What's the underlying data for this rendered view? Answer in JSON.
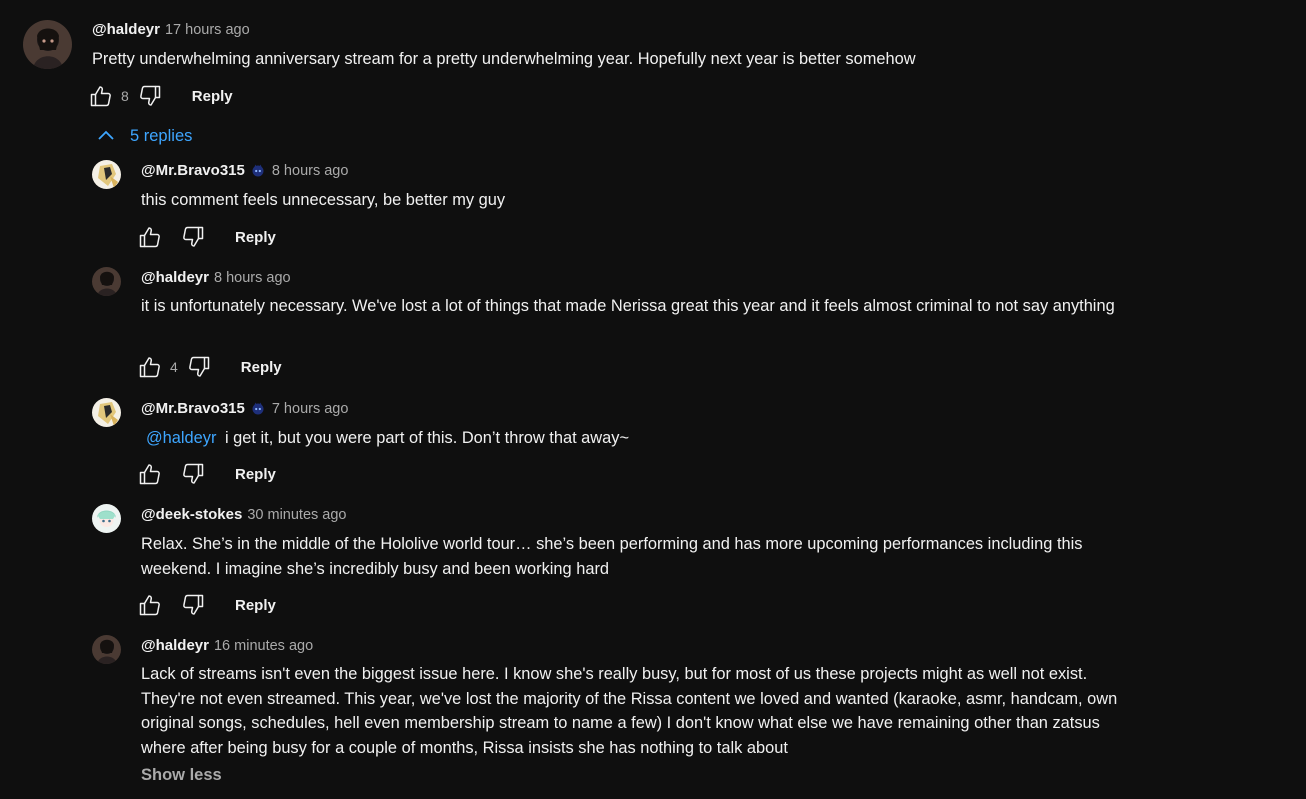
{
  "root_comment": {
    "author": "@haldeyr",
    "time": "17 hours ago",
    "text": "Pretty underwhelming anniversary stream for a pretty underwhelming year. Hopefully next year is better somehow",
    "likes": "8",
    "reply_label": "Reply",
    "avatar": "dark-haired-avatar"
  },
  "replies_toggle": {
    "label": "5 replies",
    "icon": "chevron-up-icon"
  },
  "replies": [
    {
      "author": "@Mr.Bravo315",
      "has_member_badge": true,
      "time": "8 hours ago",
      "text": "this comment feels unnecessary, be better my guy",
      "likes": "",
      "reply_label": "Reply",
      "avatar": "white-gold-avatar"
    },
    {
      "author": "@haldeyr",
      "has_member_badge": false,
      "time": "8 hours ago",
      "text": "it is unfortunately necessary. We've lost a lot of things that made Nerissa great this year and it feels almost criminal to not say anything",
      "likes": "4",
      "reply_label": "Reply",
      "avatar": "dark-haired-avatar"
    },
    {
      "author": "@Mr.Bravo315",
      "has_member_badge": true,
      "time": "7 hours ago",
      "mention": "@haldeyr",
      "text": "i get it, but you were part of this. Don’t throw that away~",
      "likes": "",
      "reply_label": "Reply",
      "avatar": "white-gold-avatar"
    },
    {
      "author": "@deek-stokes",
      "has_member_badge": false,
      "time": "30 minutes ago",
      "text": "Relax. She’s in the middle of the Hololive world tour… she’s been performing and has more upcoming performances including this weekend. I imagine she’s incredibly busy and been working hard",
      "likes": "",
      "reply_label": "Reply",
      "avatar": "green-hair-avatar"
    },
    {
      "author": "@haldeyr",
      "has_member_badge": false,
      "time": "16 minutes ago",
      "text": "Lack of streams isn't even the biggest issue here. I know she's really busy, but for most of us these projects might as well not exist. They're not even streamed. This year, we've lost the majority of the Rissa content we loved and wanted (karaoke, asmr, handcam, own original songs, schedules, hell even membership stream to name a few) I don't know what else we have remaining other than zatsus where after being busy for a couple of months, Rissa insists she has nothing to talk about",
      "show_less_label": "Show less",
      "avatar": "dark-haired-avatar"
    }
  ],
  "colors": {
    "background": "#0f0f0f",
    "text": "#f1f1f1",
    "secondary_text": "#aaaaaa",
    "link": "#3ea6ff"
  }
}
